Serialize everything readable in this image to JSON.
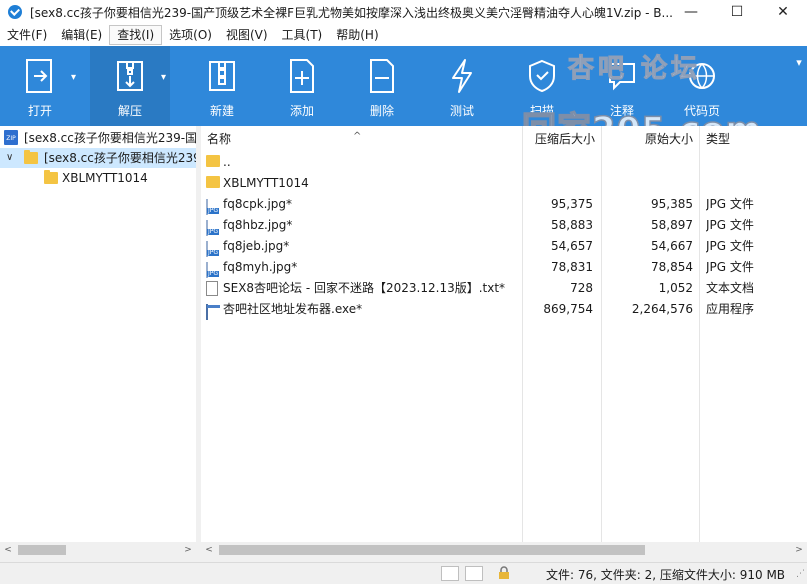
{
  "window": {
    "title": "[sex8.cc孩子你要相信光239-国产顶级艺术全裸F巨乳尤物美如按摩深入浅出终极奥义美穴淫臀精油夺人心魄1V.zip - B...",
    "minimize_glyph": "—",
    "maximize_glyph": "☐",
    "close_glyph": "✕"
  },
  "menu": [
    {
      "label": "文件(F)",
      "active": false
    },
    {
      "label": "编辑(E)",
      "active": false
    },
    {
      "label": "查找(I)",
      "active": true
    },
    {
      "label": "选项(O)",
      "active": false
    },
    {
      "label": "视图(V)",
      "active": false
    },
    {
      "label": "工具(T)",
      "active": false
    },
    {
      "label": "帮助(H)",
      "active": false
    }
  ],
  "toolbar": {
    "open": "打开",
    "extract": "解压",
    "new": "新建",
    "add": "添加",
    "delete": "删除",
    "test": "测试",
    "scan": "扫描",
    "comment": "注释",
    "codepage": "代码页"
  },
  "watermark": {
    "top": "杏吧    论坛",
    "bottom": "回家205.com"
  },
  "tree": {
    "root": "[sex8.cc孩子你要相信光239-国产",
    "archive": "[sex8.cc孩子你要相信光239",
    "subfolder": "XBLMYTT1014"
  },
  "columns": {
    "name": "名称",
    "packed": "压缩后大小",
    "size": "原始大小",
    "type": "类型"
  },
  "files": [
    {
      "name": "..",
      "packed": "",
      "size": "",
      "type": "",
      "icon": "parent-folder-icon"
    },
    {
      "name": "XBLMYTT1014",
      "packed": "",
      "size": "",
      "type": "",
      "icon": "folder-icon"
    },
    {
      "name": "fq8cpk.jpg*",
      "packed": "95,375",
      "size": "95,385",
      "type": "JPG 文件",
      "icon": "jpg-file-icon"
    },
    {
      "name": "fq8hbz.jpg*",
      "packed": "58,883",
      "size": "58,897",
      "type": "JPG 文件",
      "icon": "jpg-file-icon"
    },
    {
      "name": "fq8jeb.jpg*",
      "packed": "54,657",
      "size": "54,667",
      "type": "JPG 文件",
      "icon": "jpg-file-icon"
    },
    {
      "name": "fq8myh.jpg*",
      "packed": "78,831",
      "size": "78,854",
      "type": "JPG 文件",
      "icon": "jpg-file-icon"
    },
    {
      "name": "SEX8杏吧论坛 - 回家不迷路【2023.12.13版】.txt*",
      "packed": "728",
      "size": "1,052",
      "type": "文本文档",
      "icon": "text-file-icon"
    },
    {
      "name": "杏吧社区地址发布器.exe*",
      "packed": "869,754",
      "size": "2,264,576",
      "type": "应用程序",
      "icon": "exe-file-icon"
    }
  ],
  "status": {
    "text": "文件: 76, 文件夹: 2, 压缩文件大小: 910 MB"
  },
  "colors": {
    "toolbar": "#2f88da",
    "selection": "#cde8ff",
    "folder": "#f4c443"
  }
}
